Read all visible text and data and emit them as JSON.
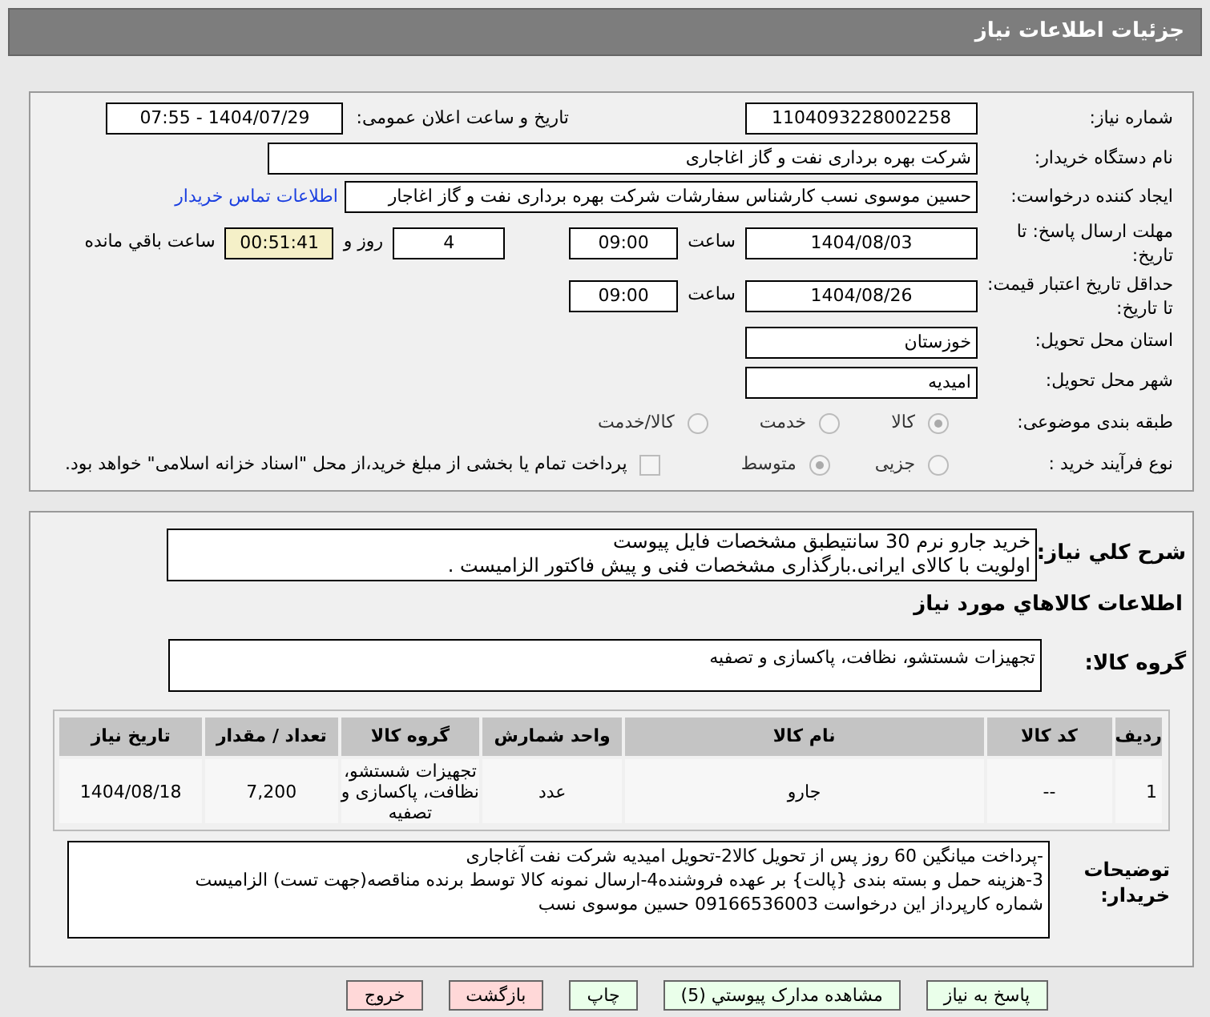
{
  "window": {
    "title": "جزئیات اطلاعات نیاز"
  },
  "need": {
    "number": {
      "label": "شماره نیاز:",
      "value": "1104093228002258"
    },
    "announce": {
      "label": "تاریخ و ساعت اعلان عمومی:",
      "value": "1404/07/29 - 07:55"
    },
    "buyer": {
      "label": "نام دستگاه خریدار:",
      "value": "شرکت بهره برداری نفت و گاز اغاجاری"
    },
    "creator": {
      "label": "ایجاد کننده درخواست:",
      "value": "حسین موسوی نسب کارشناس سفارشات شرکت بهره برداری نفت و گاز اغاجار",
      "link": "اطلاعات تماس خریدار"
    },
    "deadline": {
      "label": "مهلت ارسال پاسخ: تا تاریخ:",
      "date": "1404/08/03",
      "time_label": "ساعت",
      "time": "09:00",
      "days": "4",
      "days_label": "روز و",
      "remaining": "00:51:41",
      "remaining_label": "ساعت باقي مانده"
    },
    "validity": {
      "label": "حداقل تاریخ اعتبار قیمت: تا تاریخ:",
      "date": "1404/08/26",
      "time_label": "ساعت",
      "time": "09:00"
    },
    "province": {
      "label": "استان محل تحویل:",
      "value": "خوزستان"
    },
    "city": {
      "label": "شهر محل تحویل:",
      "value": "امیدیه"
    },
    "category": {
      "label": "طبقه بندی موضوعی:",
      "options": [
        {
          "label": "کالا",
          "selected": true
        },
        {
          "label": "خدمت",
          "selected": false
        },
        {
          "label": "کالا/خدمت",
          "selected": false
        }
      ]
    },
    "process": {
      "label": "نوع فرآیند خرید :",
      "options": [
        {
          "label": "جزیی",
          "selected": false
        },
        {
          "label": "متوسط",
          "selected": true
        }
      ],
      "payment": {
        "label": "پرداخت تمام یا بخشی از مبلغ خرید،از محل \"اسناد خزانه اسلامی\" خواهد بود.",
        "checked": false
      }
    }
  },
  "description": {
    "label": "شرح کلي نياز:",
    "lines": [
      "خرید جارو نرم 30 سانتیطبق مشخصات فایل پیوست",
      "اولویت با کالای ایرانی.بارگذاری مشخصات فنی و پیش فاکتور الزامیست ."
    ]
  },
  "goods_heading": "اطلاعات کالاهاي مورد نياز",
  "goods_group": {
    "label": "گروه کالا:",
    "value": "تجهیزات شستشو، نظافت، پاکسازی و تصفیه"
  },
  "table": {
    "columns": [
      "ردیف",
      "کد کالا",
      "نام کالا",
      "واحد شمارش",
      "گروه کالا",
      "تعداد / مقدار",
      "تاریخ نیاز"
    ],
    "rows": [
      [
        "1",
        "--",
        "جارو",
        "عدد",
        "تجهیزات شستشو، نظافت، پاکسازی و تصفیه",
        "7,200",
        "1404/08/18"
      ]
    ]
  },
  "buyer_notes": {
    "label": "توضیحات خریدار:",
    "lines": [
      "-پرداخت میانگین 60 روز پس از تحویل کالا2-تحویل امیدیه شرکت نفت آغاجاری",
      "3-هزینه حمل  و بسته بندی {پالت} بر عهده فروشنده4-ارسال نمونه کالا توسط برنده مناقصه(جهت تست) الزامیست",
      "شماره کارپرداز این درخواست 09166536003 حسین موسوی نسب"
    ]
  },
  "buttons": [
    {
      "label": "پاسخ به نیاز",
      "kind": "go"
    },
    {
      "label": "مشاهده مدارک پیوستي (5)",
      "kind": "go"
    },
    {
      "label": "چاپ",
      "kind": "go"
    },
    {
      "label": "بازگشت",
      "kind": "stop"
    },
    {
      "label": "خروج",
      "kind": "stop"
    }
  ]
}
